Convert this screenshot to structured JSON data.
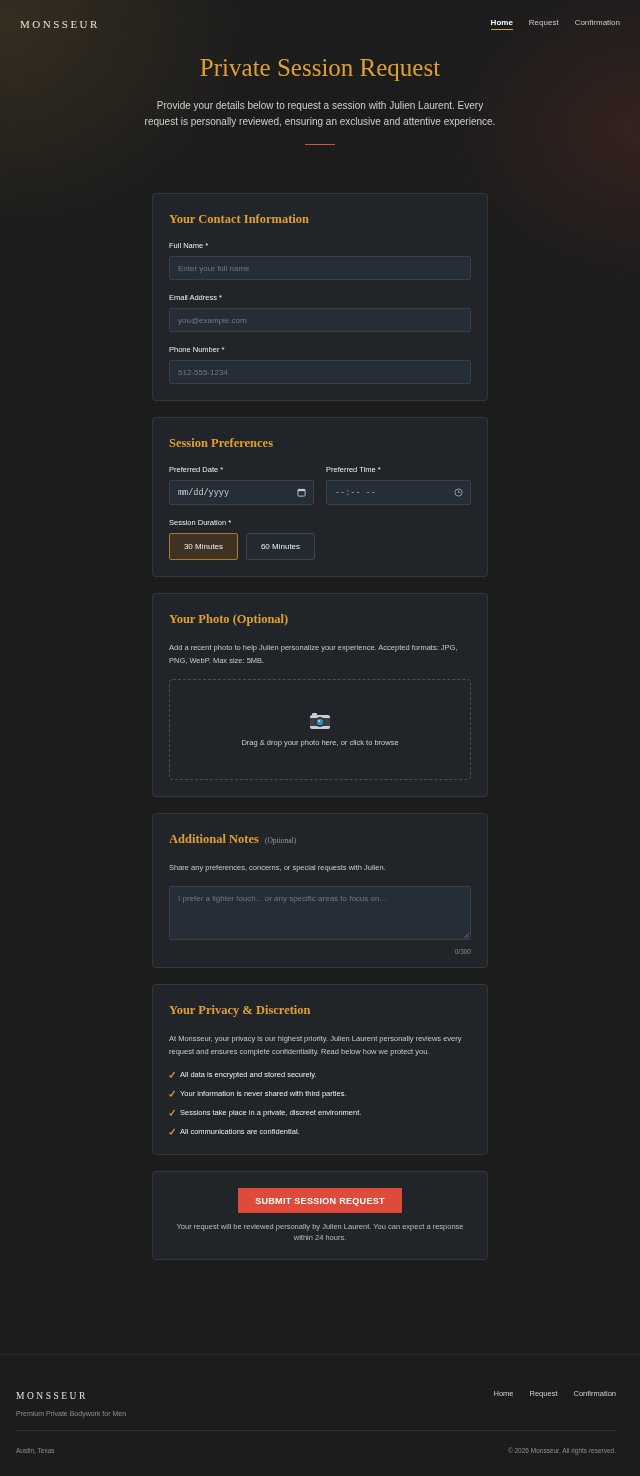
{
  "nav": {
    "brand": "MONSSEUR",
    "links": [
      {
        "label": "Home",
        "selected": true
      },
      {
        "label": "Request",
        "selected": false
      },
      {
        "label": "Confirmation",
        "selected": false
      }
    ]
  },
  "hero": {
    "title": "Private Session Request",
    "subtitle": "Provide your details below to request a session with Julien Laurent. Every request is personally reviewed, ensuring an exclusive and attentive experience."
  },
  "contact": {
    "title": "Your Contact Information",
    "fields": [
      {
        "label": "Full Name *",
        "placeholder": "Enter your full name"
      },
      {
        "label": "Email Address *",
        "placeholder": "you@example.com"
      },
      {
        "label": "Phone Number *",
        "placeholder": "512-555-1234"
      }
    ]
  },
  "preferences": {
    "title": "Session Preferences",
    "fields": [
      {
        "label": "Preferred Date *",
        "placeholder": "mm/dd/yyyy",
        "kind": "date"
      },
      {
        "label": "Preferred Time *",
        "placeholder": "--:-- --",
        "kind": "time"
      }
    ],
    "duration_label": "Session Duration *",
    "durations": [
      {
        "label": "30 Minutes",
        "selected": true
      },
      {
        "label": "60 Minutes",
        "selected": false
      }
    ]
  },
  "photo": {
    "title": "Your Photo (Optional)",
    "description": "Add a recent photo to help Julien personalize your experience. Accepted formats: JPG, PNG, WebP. Max size: 5MB.",
    "dropzone": "Drag & drop your photo here, or click to browse"
  },
  "notes": {
    "title": "Additional Notes",
    "title_note": "(Optional)",
    "description": "Share any preferences, concerns, or special requests with Julien.",
    "placeholder": "I prefer a lighter touch... or any specific areas to focus on...",
    "counter": "0/300"
  },
  "privacy": {
    "title": "Your Privacy & Discretion",
    "description": "At Monsseur, your privacy is our highest priority. Julien Laurent personally reviews every request and ensures complete confidentiality. Read below how we protect you.",
    "points": [
      "All data is encrypted and stored securely.",
      "Your information is never shared with third parties.",
      "Sessions take place in a private, discreet environment.",
      "All communications are confidential."
    ]
  },
  "submit": {
    "button": "SUBMIT SESSION REQUEST",
    "note": "Your request will be reviewed personally by Julien Laurent. You can expect a response within 24 hours."
  },
  "footer": {
    "brand": "MONSSEUR",
    "tagline": "Premium Private Bodywork for Men",
    "links": [
      "Home",
      "Request",
      "Confirmation"
    ],
    "location": "Austin, Texas",
    "copyright": "© 2026 Monsseur. All rights reserved."
  }
}
